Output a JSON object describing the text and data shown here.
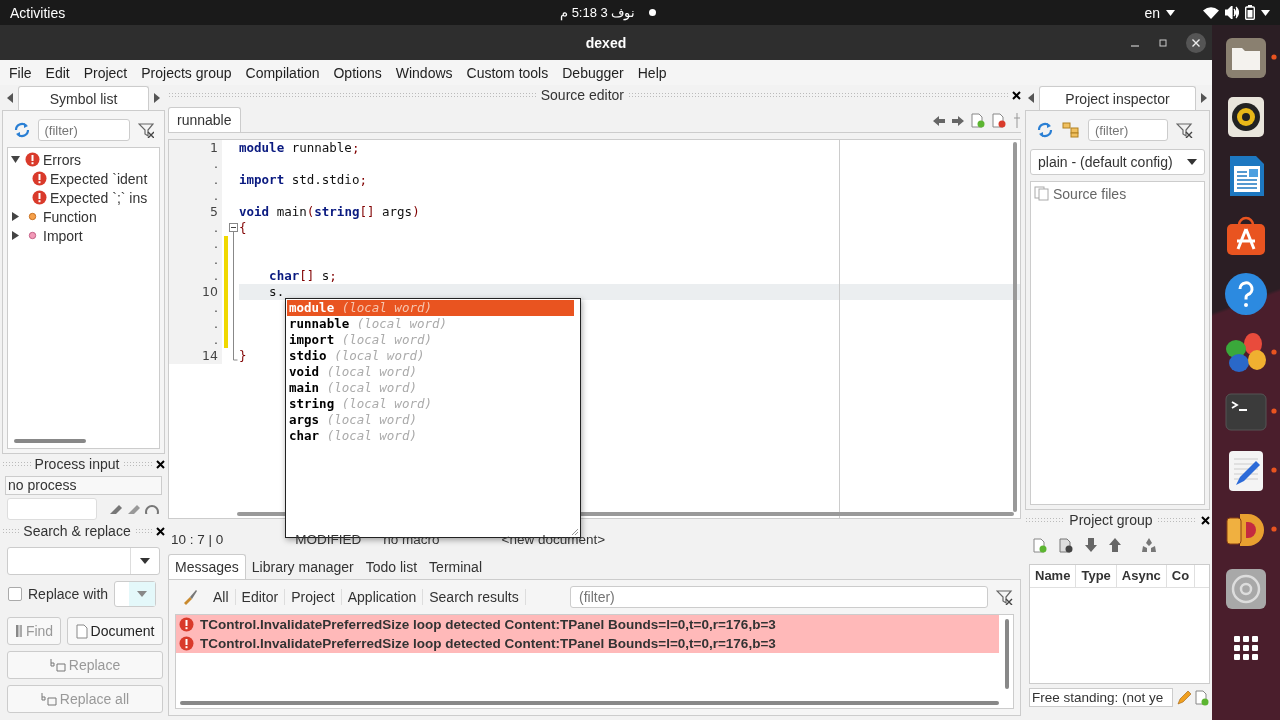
{
  "top_bar": {
    "activities": "Activities",
    "clock": "نوف 3  5:18 م",
    "language": "en"
  },
  "window": {
    "title": "dexed"
  },
  "menu": [
    "File",
    "Edit",
    "Project",
    "Projects group",
    "Compilation",
    "Options",
    "Windows",
    "Custom tools",
    "Debugger",
    "Help"
  ],
  "symbol_list": {
    "title": "Symbol list",
    "filter_placeholder": "(filter)",
    "tree": [
      {
        "label": "Errors",
        "kind": "error",
        "expanded": true,
        "children": [
          {
            "label": "Expected `ident",
            "kind": "error"
          },
          {
            "label": "Expected `;` ins",
            "kind": "error"
          }
        ]
      },
      {
        "label": "Function",
        "kind": "function",
        "expanded": false
      },
      {
        "label": "Import",
        "kind": "import",
        "expanded": false
      }
    ]
  },
  "process_input": {
    "title": "Process input",
    "status": "no process"
  },
  "search_replace": {
    "title": "Search & replace",
    "replace_with": {
      "label": "Replace with",
      "checked": false
    },
    "buttons": [
      {
        "label": "Find",
        "kind": "find",
        "disabled": true
      },
      {
        "label": "Document",
        "kind": "scope",
        "disabled": false
      },
      {
        "label": "Replace",
        "kind": "replace",
        "disabled": true
      },
      {
        "label": "Replace all",
        "kind": "replace",
        "disabled": true
      }
    ]
  },
  "source_editor": {
    "title": "Source editor",
    "tabs": [
      {
        "label": "runnable",
        "selected": true
      }
    ],
    "lines": [
      {
        "number": "1",
        "modified": false,
        "current": false,
        "code": [
          {
            "text": "module",
            "kind": "keyword"
          },
          {
            "text": " runnable",
            "kind": "plain"
          },
          {
            "text": ";",
            "kind": "symbol"
          }
        ]
      },
      {
        "number": ".",
        "modified": false,
        "current": false
      },
      {
        "number": ".",
        "modified": false,
        "current": false,
        "code": [
          {
            "text": "import",
            "kind": "keyword"
          },
          {
            "text": " std.stdio",
            "kind": "plain"
          },
          {
            "text": ";",
            "kind": "symbol"
          }
        ]
      },
      {
        "number": ".",
        "modified": false,
        "current": false
      },
      {
        "number": "5",
        "modified": false,
        "current": false,
        "code": [
          {
            "text": "void",
            "kind": "keyword"
          },
          {
            "text": " main",
            "kind": "plain"
          },
          {
            "text": "(",
            "kind": "symbol"
          },
          {
            "text": "string",
            "kind": "keyword"
          },
          {
            "text": "[]",
            "kind": "symbol"
          },
          {
            "text": " args",
            "kind": "plain"
          },
          {
            "text": ")",
            "kind": "symbol"
          }
        ]
      },
      {
        "number": ".",
        "modified": false,
        "current": false,
        "fold_start": true,
        "code": [
          {
            "text": "{",
            "kind": "symbol"
          }
        ]
      },
      {
        "number": ".",
        "modified": true,
        "current": false
      },
      {
        "number": ".",
        "modified": true,
        "current": false
      },
      {
        "number": ".",
        "modified": true,
        "current": false,
        "code": [
          {
            "text": "    char",
            "kind": "keyword"
          },
          {
            "text": "[]",
            "kind": "symbol"
          },
          {
            "text": " s",
            "kind": "plain"
          },
          {
            "text": ";",
            "kind": "symbol"
          }
        ]
      },
      {
        "number": "10",
        "modified": true,
        "current": true,
        "code": [
          {
            "text": "    s.",
            "kind": "plain"
          }
        ]
      },
      {
        "number": ".",
        "modified": true,
        "current": false
      },
      {
        "number": ".",
        "modified": true,
        "current": false
      },
      {
        "number": ".",
        "modified": true,
        "current": false
      },
      {
        "number": "14",
        "modified": false,
        "current": false,
        "fold_end": true,
        "code": [
          {
            "text": "}",
            "kind": "symbol"
          }
        ]
      }
    ],
    "completion": [
      {
        "word": "module",
        "hint": "(local word)",
        "selected": true
      },
      {
        "word": "runnable",
        "hint": "(local word)",
        "selected": false
      },
      {
        "word": "import",
        "hint": "(local word)",
        "selected": false
      },
      {
        "word": "stdio",
        "hint": "(local word)",
        "selected": false
      },
      {
        "word": "void",
        "hint": "(local word)",
        "selected": false
      },
      {
        "word": "main",
        "hint": "(local word)",
        "selected": false
      },
      {
        "word": "string",
        "hint": "(local word)",
        "selected": false
      },
      {
        "word": "args",
        "hint": "(local word)",
        "selected": false
      },
      {
        "word": "char",
        "hint": "(local word)",
        "selected": false
      }
    ],
    "status": {
      "cursor": "10 : 7 | 0",
      "state": "MODIFIED",
      "macro": "no macro",
      "document": "<new document>"
    }
  },
  "bottom_tabs": [
    {
      "label": "Messages",
      "selected": true
    },
    {
      "label": "Library manager",
      "selected": false
    },
    {
      "label": "Todo list",
      "selected": false
    },
    {
      "label": "Terminal",
      "selected": false
    }
  ],
  "messages": {
    "filters": [
      "All",
      "Editor",
      "Project",
      "Application",
      "Search results"
    ],
    "filter_placeholder": "(filter)",
    "items": [
      {
        "text": "TControl.InvalidatePreferredSize loop detected Content:TPanel Bounds=l=0,t=0,r=176,b=3",
        "kind": "error"
      },
      {
        "text": "TControl.InvalidatePreferredSize loop detected Content:TPanel Bounds=l=0,t=0,r=176,b=3",
        "kind": "error"
      }
    ]
  },
  "project_inspector": {
    "title": "Project inspector",
    "filter_placeholder": "(filter)",
    "config": "plain - (default config)",
    "tree": [
      "Source files"
    ]
  },
  "project_group": {
    "title": "Project group",
    "columns": [
      "Name",
      "Type",
      "Async",
      "Co"
    ],
    "status": "Free standing: (not ye"
  },
  "dock": [
    {
      "kind": "files",
      "running": true
    },
    {
      "kind": "music",
      "running": false
    },
    {
      "kind": "document",
      "running": false
    },
    {
      "kind": "store",
      "running": false
    },
    {
      "kind": "help",
      "running": false
    },
    {
      "kind": "cards",
      "running": true
    },
    {
      "kind": "terminal",
      "running": true
    },
    {
      "kind": "editor",
      "running": true
    },
    {
      "kind": "dexed",
      "running": true
    },
    {
      "kind": "disc",
      "running": false
    },
    {
      "kind": "apps",
      "running": false
    }
  ]
}
